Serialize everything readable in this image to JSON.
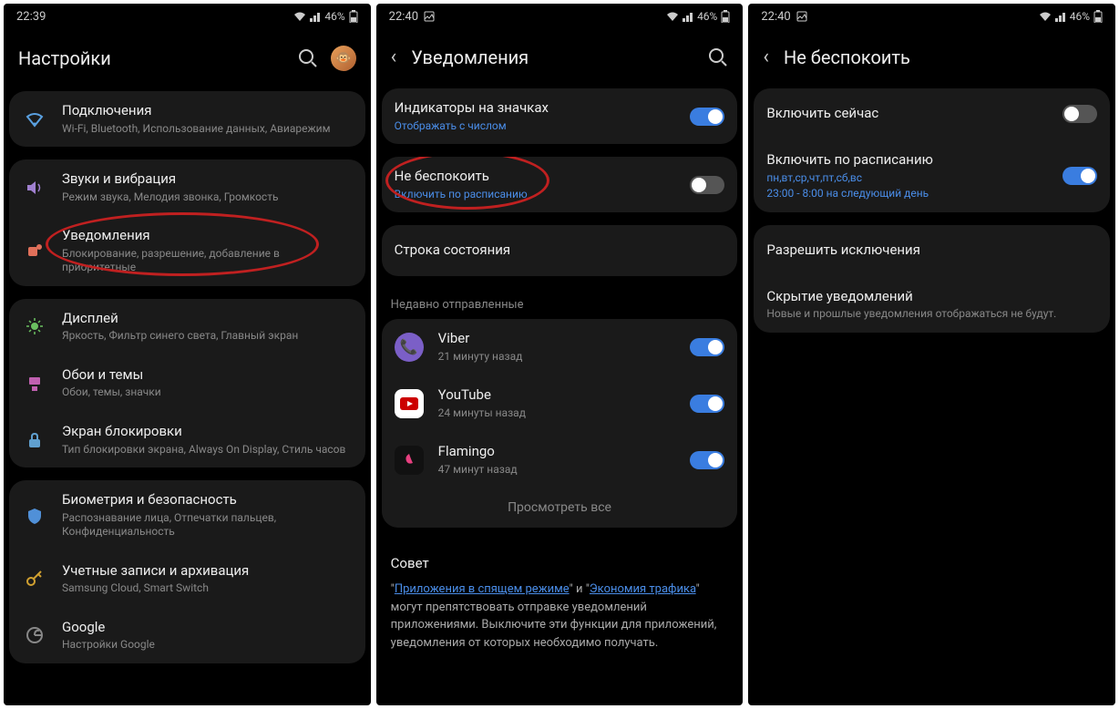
{
  "screen1": {
    "status": {
      "time": "22:39",
      "battery": "46%"
    },
    "title": "Настройки",
    "rows": [
      {
        "icon": "wifi",
        "title": "Подключения",
        "sub": "Wi-Fi, Bluetooth, Использование данных, Авиарежим"
      },
      {
        "icon": "sound",
        "title": "Звуки и вибрация",
        "sub": "Режим звука, Мелодия звонка, Громкость"
      },
      {
        "icon": "notif",
        "title": "Уведомления",
        "sub": "Блокирование, разрешение, добавление в приоритетные"
      },
      {
        "icon": "display",
        "title": "Дисплей",
        "sub": "Яркость, Фильтр синего света, Главный экран"
      },
      {
        "icon": "wallpaper",
        "title": "Обои и темы",
        "sub": "Обои, темы, значки"
      },
      {
        "icon": "lock",
        "title": "Экран блокировки",
        "sub": "Тип блокировки экрана, Always On Display, Стиль часов"
      },
      {
        "icon": "biometric",
        "title": "Биометрия и безопасность",
        "sub": "Распознавание лица, Отпечатки пальцев, Конфиденциальность"
      },
      {
        "icon": "accounts",
        "title": "Учетные записи и архивация",
        "sub": "Samsung Cloud, Smart Switch"
      },
      {
        "icon": "google",
        "title": "Google",
        "sub": "Настройки Google"
      }
    ]
  },
  "screen2": {
    "status": {
      "time": "22:40",
      "battery": "46%"
    },
    "title": "Уведомления",
    "badge": {
      "title": "Индикаторы на значках",
      "sub": "Отображать с числом",
      "on": true
    },
    "dnd": {
      "title": "Не беспокоить",
      "sub": "Включить по расписанию",
      "on": false
    },
    "statusbar": {
      "title": "Строка состояния"
    },
    "recent_label": "Недавно отправленные",
    "apps": [
      {
        "name": "Viber",
        "sub": "21 минуту назад",
        "color": "#7b5fc7",
        "on": true
      },
      {
        "name": "YouTube",
        "sub": "24 минуты назад",
        "color": "#cc0000",
        "on": true
      },
      {
        "name": "Flamingo",
        "sub": "47 минут назад",
        "color": "#111",
        "on": true
      }
    ],
    "view_all": "Просмотреть все",
    "tip_title": "Совет",
    "tip_link1": "Приложения в спящем режиме",
    "tip_mid": " и ",
    "tip_link2": "Экономия трафика",
    "tip_rest": " могут препятствовать отправке уведомлений приложениями. Выключите эти функции для приложений, уведомления от которых необходимо получать."
  },
  "screen3": {
    "status": {
      "time": "22:40",
      "battery": "46%"
    },
    "title": "Не беспокоить",
    "now": {
      "title": "Включить сейчас",
      "on": false
    },
    "sched": {
      "title": "Включить по расписанию",
      "sub1": "пн,вт,ср,чт,пт,сб,вс",
      "sub2": "23:00 - 8:00 на следующий день",
      "on": true
    },
    "exceptions": {
      "title": "Разрешить исключения"
    },
    "hide": {
      "title": "Скрытие уведомлений",
      "sub": "Новые и прошлые уведомления отображаться не будут."
    }
  }
}
